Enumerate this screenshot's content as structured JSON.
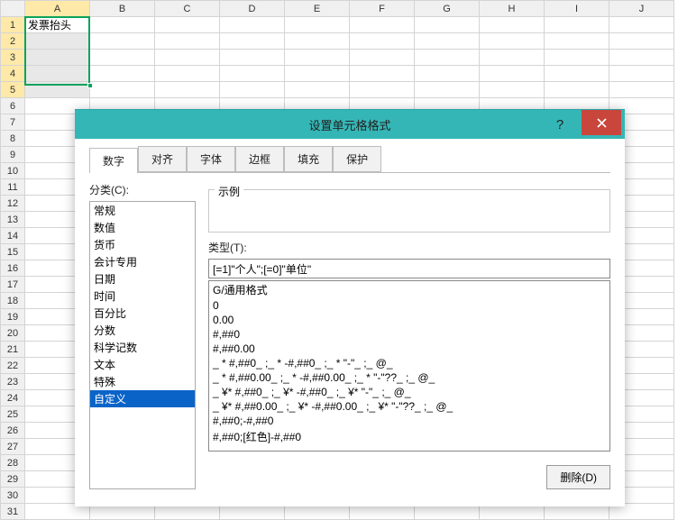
{
  "sheet": {
    "columns": [
      "A",
      "B",
      "C",
      "D",
      "E",
      "F",
      "G",
      "H",
      "I",
      "J"
    ],
    "rows": [
      "1",
      "2",
      "3",
      "4",
      "5",
      "6",
      "7",
      "8",
      "9",
      "10",
      "11",
      "12",
      "13",
      "14",
      "15",
      "16",
      "17",
      "18",
      "19",
      "20",
      "21",
      "22",
      "23",
      "24",
      "25",
      "26",
      "27",
      "28",
      "29",
      "30",
      "31"
    ],
    "a1": "发票抬头",
    "highlight_col_index": 0,
    "highlight_row_start": 0,
    "highlight_row_end": 4,
    "selection": {
      "row_start": 1,
      "row_end": 4
    }
  },
  "dialog": {
    "title": "设置单元格格式",
    "help_tooltip": "?",
    "close_tooltip": "✕",
    "tabs": [
      "数字",
      "对齐",
      "字体",
      "边框",
      "填充",
      "保护"
    ],
    "active_tab_index": 0,
    "category_label": "分类(C):",
    "categories": [
      "常规",
      "数值",
      "货币",
      "会计专用",
      "日期",
      "时间",
      "百分比",
      "分数",
      "科学记数",
      "文本",
      "特殊",
      "自定义"
    ],
    "selected_category_index": 11,
    "sample_label": "示例",
    "sample_value": "",
    "type_label": "类型(T):",
    "type_value": "[=1]\"个人\";[=0]\"单位\"",
    "formats": [
      "G/通用格式",
      "0",
      "0.00",
      "#,##0",
      "#,##0.00",
      "_ * #,##0_ ;_ * -#,##0_ ;_ * \"-\"_ ;_ @_ ",
      "_ * #,##0.00_ ;_ * -#,##0.00_ ;_ * \"-\"??_ ;_ @_ ",
      "_ ¥* #,##0_ ;_ ¥* -#,##0_ ;_ ¥* \"-\"_ ;_ @_ ",
      "_ ¥* #,##0.00_ ;_ ¥* -#,##0.00_ ;_ ¥* \"-\"??_ ;_ @_ ",
      "#,##0;-#,##0",
      "#,##0;[红色]-#,##0"
    ],
    "delete_label": "删除(D)"
  }
}
